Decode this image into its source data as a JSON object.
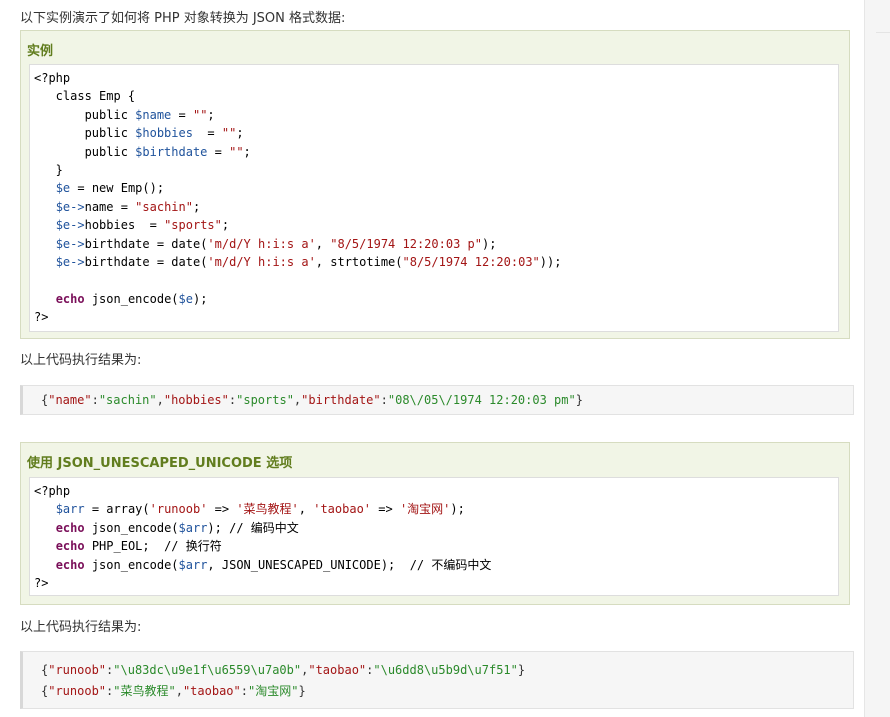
{
  "intro_text": "以下实例演示了如何将 PHP 对象转换为 JSON 格式数据:",
  "example1": {
    "title": "实例",
    "lines": [
      "<?php",
      "   class Emp {",
      "       public $name = \"\";",
      "       public $hobbies  = \"\";",
      "       public $birthdate = \"\";",
      "   }",
      "   $e = new Emp();",
      "   $e->name = \"sachin\";",
      "   $e->hobbies  = \"sports\";",
      "   $e->birthdate = date('m/d/Y h:i:s a', \"8/5/1974 12:20:03 p\");",
      "   $e->birthdate = date('m/d/Y h:i:s a', strtotime(\"8/5/1974 12:20:03\"));",
      "",
      "   echo json_encode($e);",
      "?>"
    ]
  },
  "result_label_1": "以上代码执行结果为:",
  "result1": {
    "lines": [
      "{\"name\":\"sachin\",\"hobbies\":\"sports\",\"birthdate\":\"08\\/05\\/1974 12:20:03 pm\"}"
    ]
  },
  "example2": {
    "title": "使用 JSON_UNESCAPED_UNICODE 选项",
    "lines": [
      "<?php",
      "   $arr = array('runoob' => '菜鸟教程', 'taobao' => '淘宝网');",
      "   echo json_encode($arr); // 编码中文",
      "   echo PHP_EOL;  // 换行符",
      "   echo json_encode($arr, JSON_UNESCAPED_UNICODE);  // 不编码中文",
      "?>"
    ]
  },
  "result_label_2": "以上代码执行结果为:",
  "result2": {
    "lines": [
      "{\"runoob\":\"\\u83dc\\u9e1f\\u6559\\u7a0b\",\"taobao\":\"\\u6dd8\\u5b9d\\u7f51\"}",
      "{\"runoob\":\"菜鸟教程\",\"taobao\":\"淘宝网\"}"
    ]
  },
  "colors": {
    "example_title": "#617d1e",
    "example_bg": "#f1f5e6",
    "variable": "#20539c",
    "string": "#a31515",
    "keyword": "#7a0f59",
    "result_value": "#2b8a2b"
  }
}
